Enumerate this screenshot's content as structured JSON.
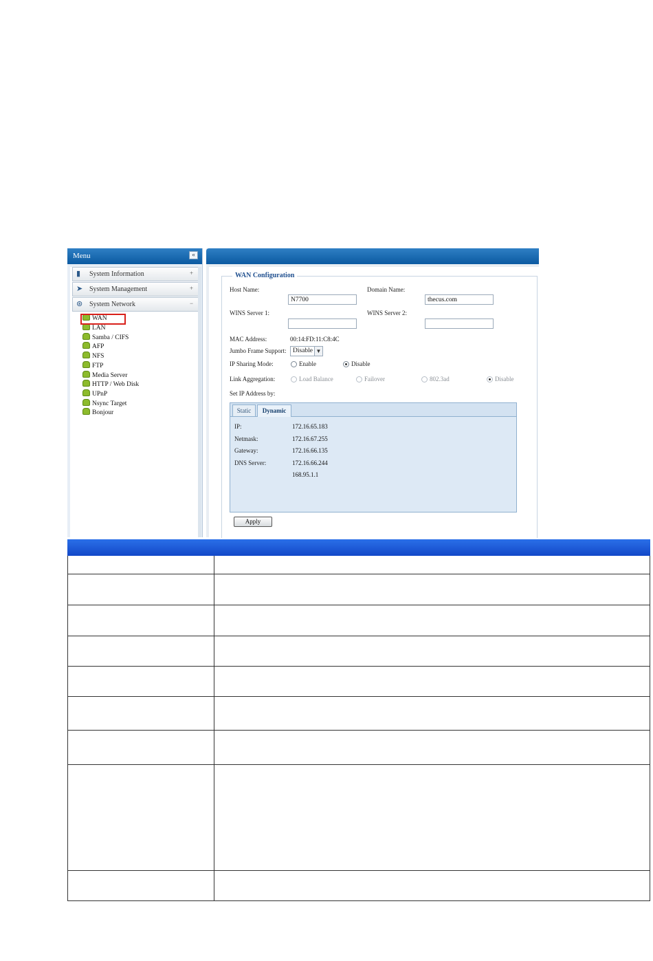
{
  "menu": {
    "title": "Menu",
    "collapse_icon": "«",
    "categories": [
      {
        "label": "System Information",
        "icon": "info-book-icon",
        "toggle": "+"
      },
      {
        "label": "System Management",
        "icon": "management-icon",
        "toggle": "+"
      },
      {
        "label": "System Network",
        "icon": "network-icon",
        "toggle": "−"
      }
    ],
    "items": [
      "WAN",
      "LAN",
      "Samba / CIFS",
      "AFP",
      "NFS",
      "FTP",
      "Media Server",
      "HTTP / Web Disk",
      "UPnP",
      "Nsync Target",
      "Bonjour"
    ]
  },
  "wan": {
    "legend": "WAN Configuration",
    "host_name_label": "Host Name:",
    "host_name_value": "N7700",
    "domain_name_label": "Domain Name:",
    "domain_name_value": "thecus.com",
    "wins1_label": "WINS Server 1:",
    "wins1_value": "",
    "wins2_label": "WINS Server 2:",
    "wins2_value": "",
    "mac_label": "MAC Address:",
    "mac_value": "00:14:FD:11:C8:4C",
    "jumbo_label": "Jumbo Frame Support:",
    "jumbo_value": "Disable",
    "ip_sharing_label": "IP Sharing Mode:",
    "ip_sharing_options": [
      "Enable",
      "Disable"
    ],
    "ip_sharing_selected": "Disable",
    "link_agg_label": "Link Aggregation:",
    "link_agg_options": [
      "Load Balance",
      "Failover",
      "802.3ad",
      "Disable"
    ],
    "link_agg_selected": "Disable",
    "set_ip_label": "Set IP Address by:",
    "tabs": [
      "Static",
      "Dynamic"
    ],
    "active_tab": "Dynamic",
    "ip_label": "IP:",
    "ip_value": "172.16.65.183",
    "netmask_label": "Netmask:",
    "netmask_value": "172.16.67.255",
    "gateway_label": "Gateway:",
    "gateway_value": "172.16.66.135",
    "dns_label": "DNS Server:",
    "dns_value1": "172.16.66.244",
    "dns_value2": "168.95.1.1",
    "apply_label": "Apply"
  },
  "colors": {
    "header_blue": "#0b5aa1",
    "table_header_blue": "#1348c8",
    "highlight_red": "#d8201a"
  }
}
